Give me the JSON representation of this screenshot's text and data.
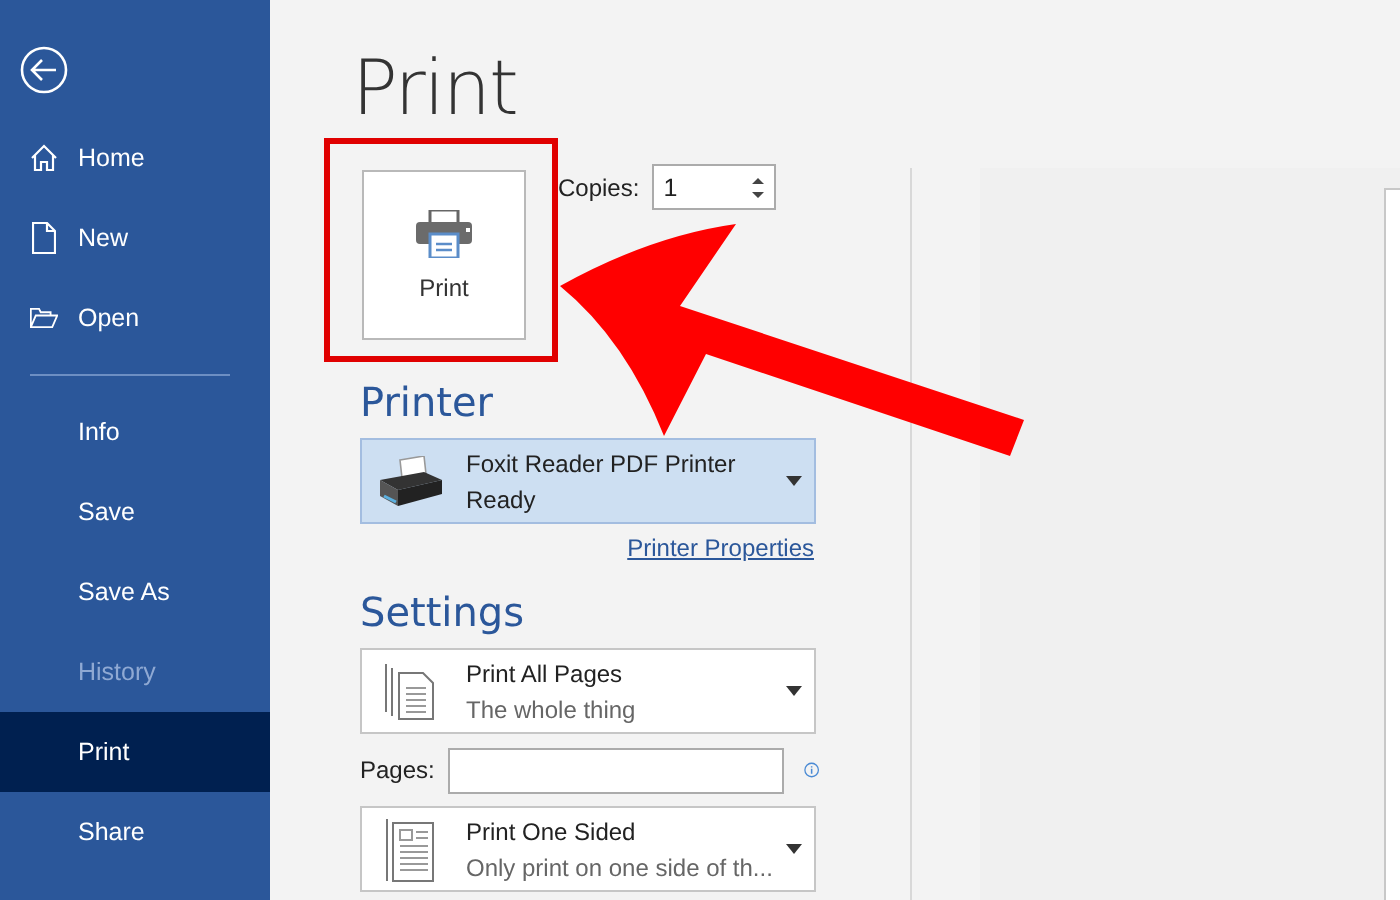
{
  "sidebar": {
    "top_items": [
      {
        "label": "Home",
        "selected": false
      },
      {
        "label": "New",
        "selected": false
      },
      {
        "label": "Open",
        "selected": false
      }
    ],
    "items": [
      {
        "label": "Info",
        "selected": false,
        "disabled": false
      },
      {
        "label": "Save",
        "selected": false,
        "disabled": false
      },
      {
        "label": "Save As",
        "selected": false,
        "disabled": false
      },
      {
        "label": "History",
        "selected": false,
        "disabled": true
      },
      {
        "label": "Print",
        "selected": true,
        "disabled": false
      },
      {
        "label": "Share",
        "selected": false,
        "disabled": false
      }
    ]
  },
  "page": {
    "title": "Print",
    "print_button": {
      "label": "Print"
    },
    "copies": {
      "label": "Copies:",
      "value": "1"
    },
    "printer": {
      "heading": "Printer",
      "name": "Foxit Reader PDF Printer",
      "status": "Ready",
      "properties_link": "Printer Properties"
    },
    "settings": {
      "heading": "Settings",
      "options": [
        {
          "title": "Print All Pages",
          "subtitle": "The whole thing"
        },
        {
          "title": "Print One Sided",
          "subtitle": "Only print on one side of th..."
        }
      ],
      "pages": {
        "label": "Pages:"
      }
    }
  }
}
